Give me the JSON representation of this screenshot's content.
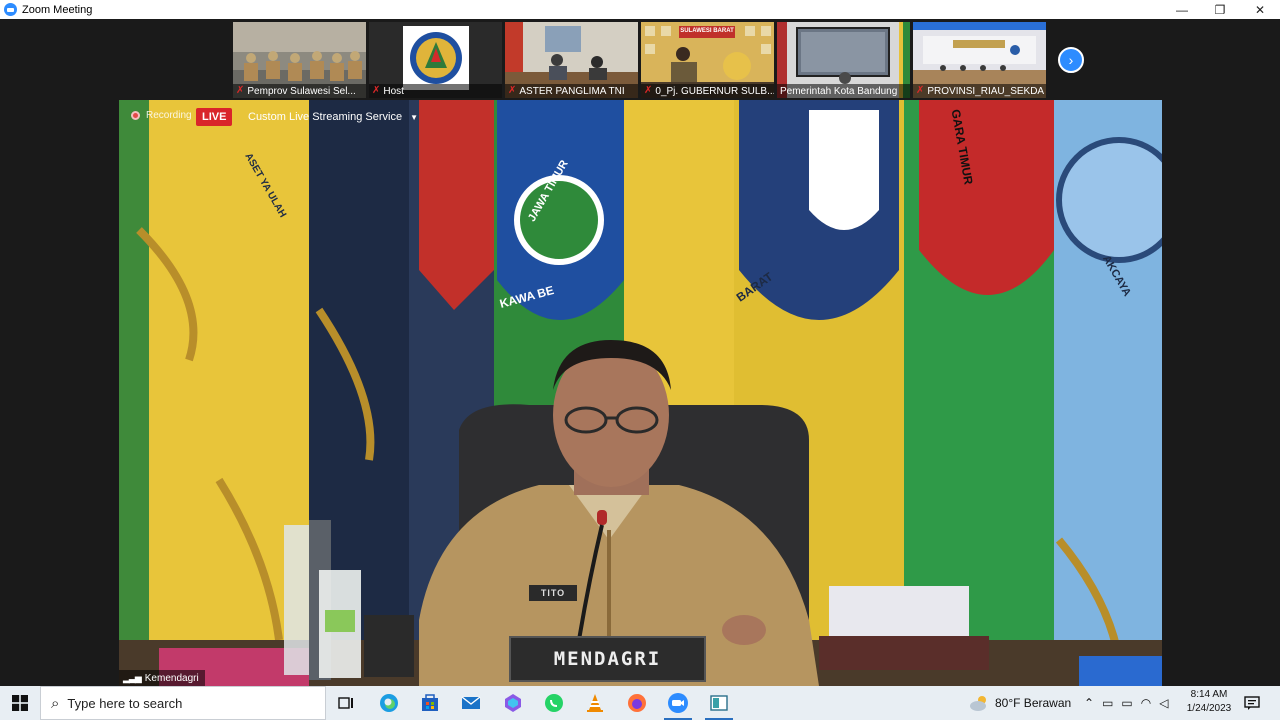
{
  "window": {
    "title": "Zoom Meeting",
    "minimize": "—",
    "maximize": "❐",
    "close": "✕"
  },
  "participants": [
    {
      "name": "Pemprov Sulawesi Sel..."
    },
    {
      "name": "Host"
    },
    {
      "name": "ASTER PANGLIMA TNI"
    },
    {
      "name": "0_Pj. GUBERNUR SULB..."
    },
    {
      "name": "Pemerintah Kota Bandung"
    },
    {
      "name": "PROVINSI_RIAU_SEKDA"
    }
  ],
  "thumbnail_overlay": {
    "label": "SULAWESI BARAT"
  },
  "main_video": {
    "recording_label": "Recording",
    "live_label": "LIVE",
    "stream_label": "Custom Live Streaming Service",
    "speaker_name": "Kemendagri",
    "nameplate": "MENDAGRI",
    "name_tag": "TITO",
    "flag_texts": [
      "JAWA TIMUR",
      "KAWA BE",
      "BARAT",
      "GARA TIMUR",
      "AKCAYA",
      "ASET YA ULAH"
    ]
  },
  "taskbar": {
    "search_placeholder": "Type here to search",
    "weather": "80°F  Berawan",
    "time": "8:14 AM",
    "date": "1/24/2023"
  }
}
